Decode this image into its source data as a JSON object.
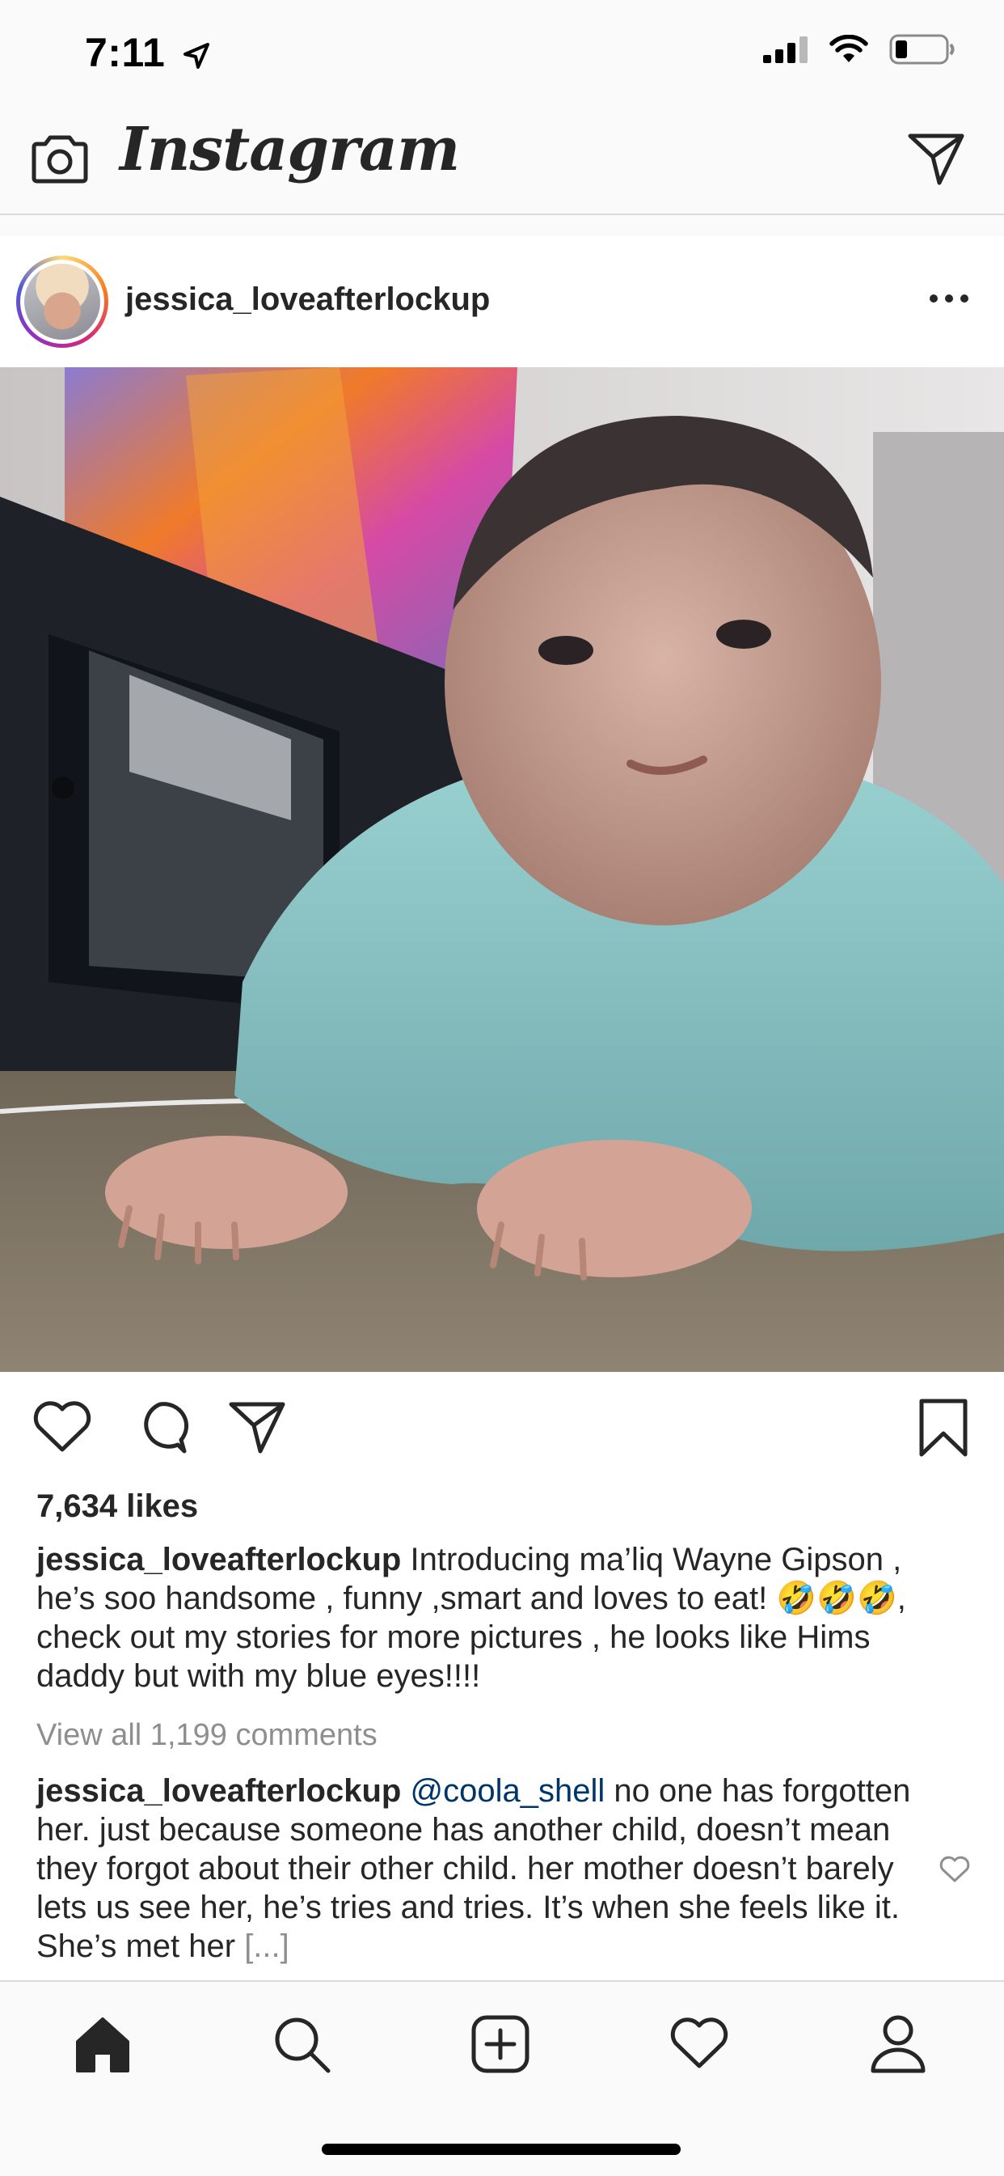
{
  "status_bar": {
    "time": "7:11",
    "icons": [
      "location-arrow-icon",
      "signal-icon",
      "wifi-icon",
      "battery-icon"
    ]
  },
  "topbar": {
    "logo": "Instagram",
    "icons": [
      "camera-icon",
      "direct-message-icon"
    ]
  },
  "post": {
    "username": "jessica_loveafterlockup",
    "icons": [
      "more-options-icon",
      "heart-icon",
      "comment-icon",
      "share-icon",
      "bookmark-icon"
    ],
    "likes": "7,634 likes",
    "caption_user": "jessica_loveafterlockup",
    "caption_text": "Introducing ma’liq Wayne Gipson , he’s soo handsome , funny ,smart and loves to eat! 🤣🤣🤣, check out my stories for more pictures , he looks like Hims daddy but with my blue eyes!!!!",
    "view_comments": "View all 1,199 comments",
    "comment_user": "jessica_loveafterlockup",
    "comment_mention": "@coola_shell",
    "comment_text": "no one has forgotten her. just because someone has another child, doesn’t mean they forgot about their other child. her mother doesn’t barely lets us see her, he’s tries and tries. It’s when she feels like it. She’s met her",
    "comment_more": "[...]"
  },
  "tabbar": {
    "tabs": [
      "home-icon",
      "search-icon",
      "new-post-icon",
      "activity-icon",
      "profile-icon"
    ]
  },
  "colors": {
    "text": "#262626",
    "secondary": "#8e8e8e",
    "mention": "#003569",
    "bar_bg": "#fafafa",
    "border": "#dbdbdb"
  }
}
